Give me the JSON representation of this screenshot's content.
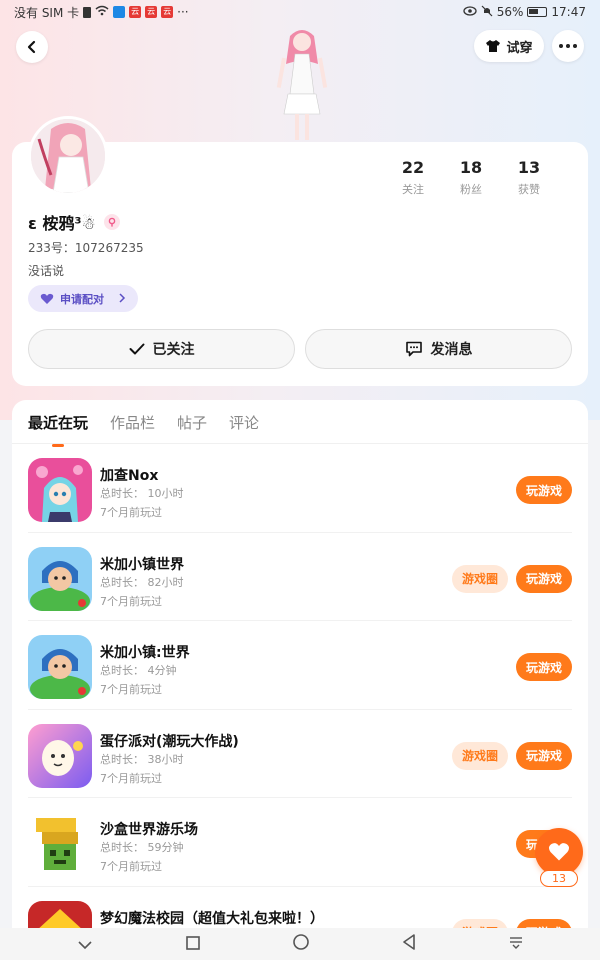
{
  "status_bar": {
    "carrier": "没有 SIM 卡",
    "battery": "56%",
    "time": "17:47",
    "notif_badges": [
      "云",
      "云",
      "云"
    ]
  },
  "header": {
    "tryon_label": "试穿"
  },
  "profile": {
    "nickname": "ε 桉鸦³☃",
    "user_id": "233号：107267235",
    "bio": "没话说",
    "pair_label": "申请配对",
    "stats": [
      {
        "value": "22",
        "label": "关注"
      },
      {
        "value": "18",
        "label": "粉丝"
      },
      {
        "value": "13",
        "label": "获赞"
      }
    ],
    "follow_label": "已关注",
    "message_label": "发消息"
  },
  "tabs": [
    {
      "label": "最近在玩",
      "active": true
    },
    {
      "label": "作品栏",
      "active": false
    },
    {
      "label": "帖子",
      "active": false
    },
    {
      "label": "评论",
      "active": false
    }
  ],
  "games": [
    {
      "name": "加查Nox",
      "duration": "总时长：  10小时",
      "last_played": "7个月前玩过",
      "has_circle": false,
      "icon": "gacha-nox-icon"
    },
    {
      "name": "米加小镇世界",
      "duration": "总时长：  82小时",
      "last_played": "7个月前玩过",
      "has_circle": true,
      "icon": "miga-town-world-icon"
    },
    {
      "name": "米加小镇:世界",
      "duration": "总时长：  4分钟",
      "last_played": "7个月前玩过",
      "has_circle": false,
      "icon": "miga-town-world-icon"
    },
    {
      "name": "蛋仔派对(潮玩大作战)",
      "duration": "总时长：  38小时",
      "last_played": "7个月前玩过",
      "has_circle": true,
      "icon": "eggy-party-icon"
    },
    {
      "name": "沙盒世界游乐场",
      "duration": "总时长：  59分钟",
      "last_played": "7个月前玩过",
      "has_circle": false,
      "icon": "sandbox-playground-icon"
    },
    {
      "name": "梦幻魔法校园（超值大礼包来啦！）",
      "duration": "",
      "last_played": "",
      "has_circle": true,
      "icon": "magic-campus-icon"
    }
  ],
  "game_buttons": {
    "play_label": "玩游戏",
    "circle_label": "游戏圈"
  },
  "float_like": {
    "count": "13"
  },
  "colors": {
    "accent": "#ff7a1a",
    "pair_purple": "#5b4fc4"
  }
}
